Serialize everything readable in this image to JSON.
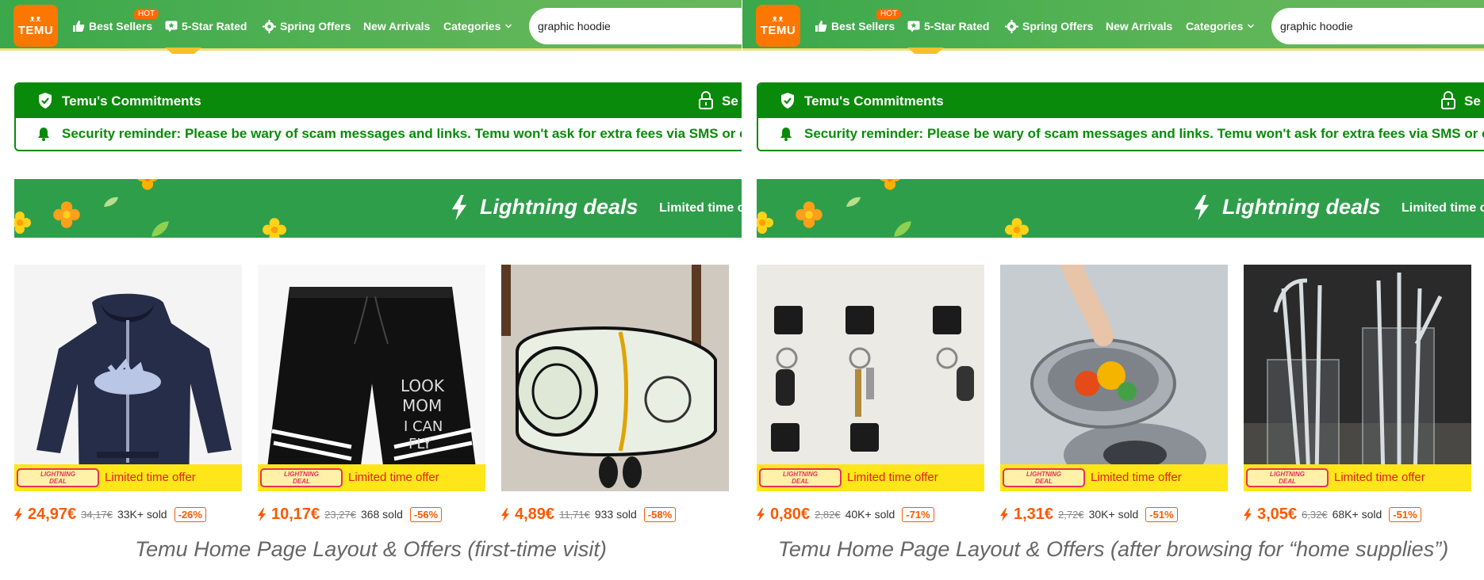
{
  "nav": {
    "logo_mascot": "ᴥᴥ",
    "logo_text": "TEMU",
    "hot_badge": "HOT",
    "items": [
      "Best Sellers",
      "5-Star Rated",
      "Spring Offers",
      "New Arrivals",
      "Categories"
    ],
    "search_value": "graphic hoodie"
  },
  "commitments": {
    "title": "Temu's Commitments",
    "security_partial": "Se",
    "reminder": "Security reminder: Please be wary of scam messages and links. Temu won't ask for extra fees via SMS or email."
  },
  "banner": {
    "title": "Lightning deals",
    "subtitle": "Limited time offer"
  },
  "deal": {
    "logo_line1": "LIGHTNING",
    "logo_line2": "DEAL",
    "text": "Limited time offer"
  },
  "panels": [
    {
      "caption": "Temu Home Page Layout & Offers (first-time visit)",
      "products": [
        {
          "image": "navy-zip-hoodie-image",
          "price": "24,97€",
          "old_price": "34,17€",
          "sold": "33K+ sold",
          "discount": "-26%"
        },
        {
          "image": "black-graphic-shorts-image",
          "price": "10,17€",
          "old_price": "23,27€",
          "sold": "368 sold",
          "discount": "-56%"
        },
        {
          "image": "money-roll-rug-image",
          "price": "4,89€",
          "old_price": "11,71€",
          "sold": "933 sold",
          "discount": "-58%"
        }
      ]
    },
    {
      "caption": "Temu Home Page Layout & Offers (after browsing for “home supplies”)",
      "products": [
        {
          "image": "wall-hooks-keys-image",
          "price": "0,80€",
          "old_price": "2,82€",
          "sold": "40K+ sold",
          "discount": "-71%"
        },
        {
          "image": "sink-strainer-image",
          "price": "1,31€",
          "old_price": "2,72€",
          "sold": "30K+ sold",
          "discount": "-51%"
        },
        {
          "image": "glass-straws-image",
          "price": "3,05€",
          "old_price": "6,32€",
          "sold": "68K+ sold",
          "discount": "-51%"
        }
      ]
    }
  ],
  "colors": {
    "nav_green": "#3aa84b",
    "temu_orange": "#fb7701",
    "commit_green": "#0a8a0a",
    "deal_yellow": "#ffe61a",
    "price_orange": "#fb5a00"
  }
}
